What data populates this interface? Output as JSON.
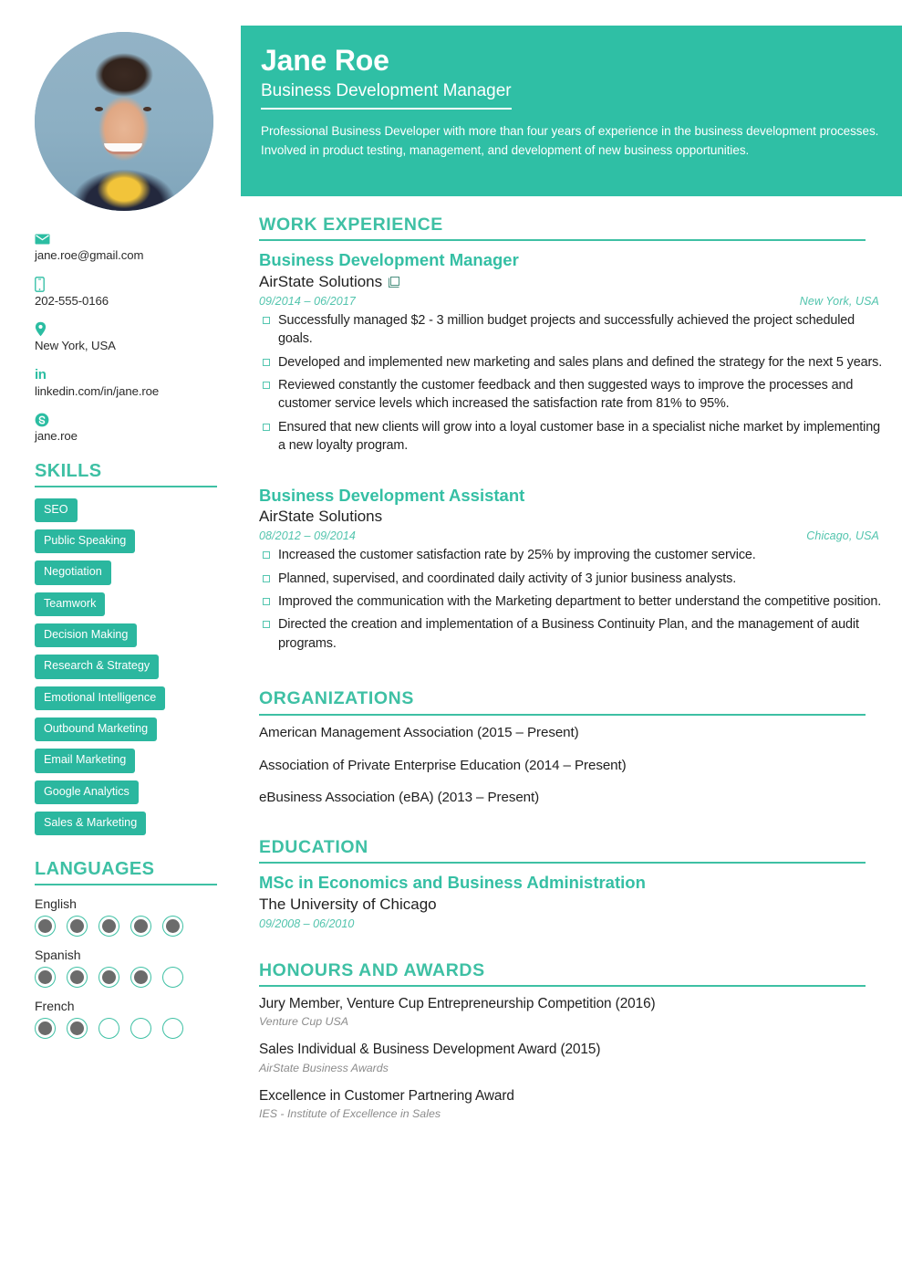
{
  "theme": {
    "teal": "#2fbfa5",
    "teal_head": "#3ec0a4",
    "teal_tag": "#2bb79f",
    "teal_italic": "#52c4ad",
    "text_dark": "#1f1f1f",
    "muted_italic": "#8c8c8c"
  },
  "header": {
    "name": "Jane Roe",
    "job_title": "Business Development Manager",
    "summary": "Professional Business Developer with more than four years of experience in the business development processes. Involved in product testing, management, and development of new business opportunities."
  },
  "contact": {
    "items": [
      {
        "icon": "envelope-icon",
        "value": "jane.roe@gmail.com"
      },
      {
        "icon": "mobile-phone-icon",
        "value": "202-555-0166"
      },
      {
        "icon": "location-pin-icon",
        "value": "New York, USA"
      },
      {
        "icon": "linkedin-icon",
        "value": "linkedin.com/in/jane.roe"
      },
      {
        "icon": "skype-icon",
        "value": "jane.roe"
      }
    ]
  },
  "skills": {
    "heading": "SKILLS",
    "items": [
      "SEO",
      "Public Speaking",
      "Negotiation",
      "Teamwork",
      "Decision Making",
      "Research & Strategy",
      "Emotional Intelligence",
      "Outbound Marketing",
      "Email Marketing",
      "Google Analytics",
      "Sales & Marketing"
    ]
  },
  "languages": {
    "heading": "LANGUAGES",
    "max_level": 5,
    "items": [
      {
        "name": "English",
        "level": 5
      },
      {
        "name": "Spanish",
        "level": 4
      },
      {
        "name": "French",
        "level": 2
      }
    ]
  },
  "work_experience": {
    "heading": "WORK EXPERIENCE",
    "jobs": [
      {
        "title": "Business Development Manager",
        "company": "AirState Solutions",
        "has_link": true,
        "dates": "09/2014 – 06/2017",
        "location": "New York, USA",
        "bullets": [
          "Successfully managed $2 - 3 million budget projects and successfully achieved the project scheduled goals.",
          "Developed and implemented new marketing and sales plans and defined the strategy for the next 5 years.",
          "Reviewed constantly the customer feedback and then suggested ways to improve the processes and customer service levels which increased the satisfaction rate from 81% to 95%.",
          "Ensured that new clients will grow into a loyal customer base in a specialist niche market by implementing a new loyalty program."
        ]
      },
      {
        "title": "Business Development Assistant",
        "company": "AirState Solutions",
        "has_link": false,
        "dates": "08/2012 – 09/2014",
        "location": "Chicago, USA",
        "bullets": [
          "Increased the customer satisfaction rate by 25% by improving the customer service.",
          "Planned, supervised, and coordinated daily activity of 3 junior business analysts.",
          "Improved the communication with the Marketing department to better understand the competitive position.",
          "Directed the creation and implementation of a Business Continuity Plan, and the management of audit programs."
        ]
      }
    ]
  },
  "organizations": {
    "heading": "ORGANIZATIONS",
    "items": [
      "American Management Association (2015 – Present)",
      "Association of Private Enterprise Education (2014 – Present)",
      "eBusiness Association (eBA) (2013 – Present)"
    ]
  },
  "education": {
    "heading": "EDUCATION",
    "degree": "MSc in Economics and Business Administration",
    "school": "The University of Chicago",
    "dates": "09/2008 – 06/2010"
  },
  "honours": {
    "heading": "HONOURS AND AWARDS",
    "items": [
      {
        "title": "Jury Member, Venture Cup Entrepreneurship Competition (2016)",
        "sub": "Venture Cup USA"
      },
      {
        "title": "Sales Individual & Business Development Award (2015)",
        "sub": "AirState Business Awards"
      },
      {
        "title": "Excellence in Customer Partnering Award",
        "sub": "IES - Institute of Excellence in Sales"
      }
    ]
  }
}
